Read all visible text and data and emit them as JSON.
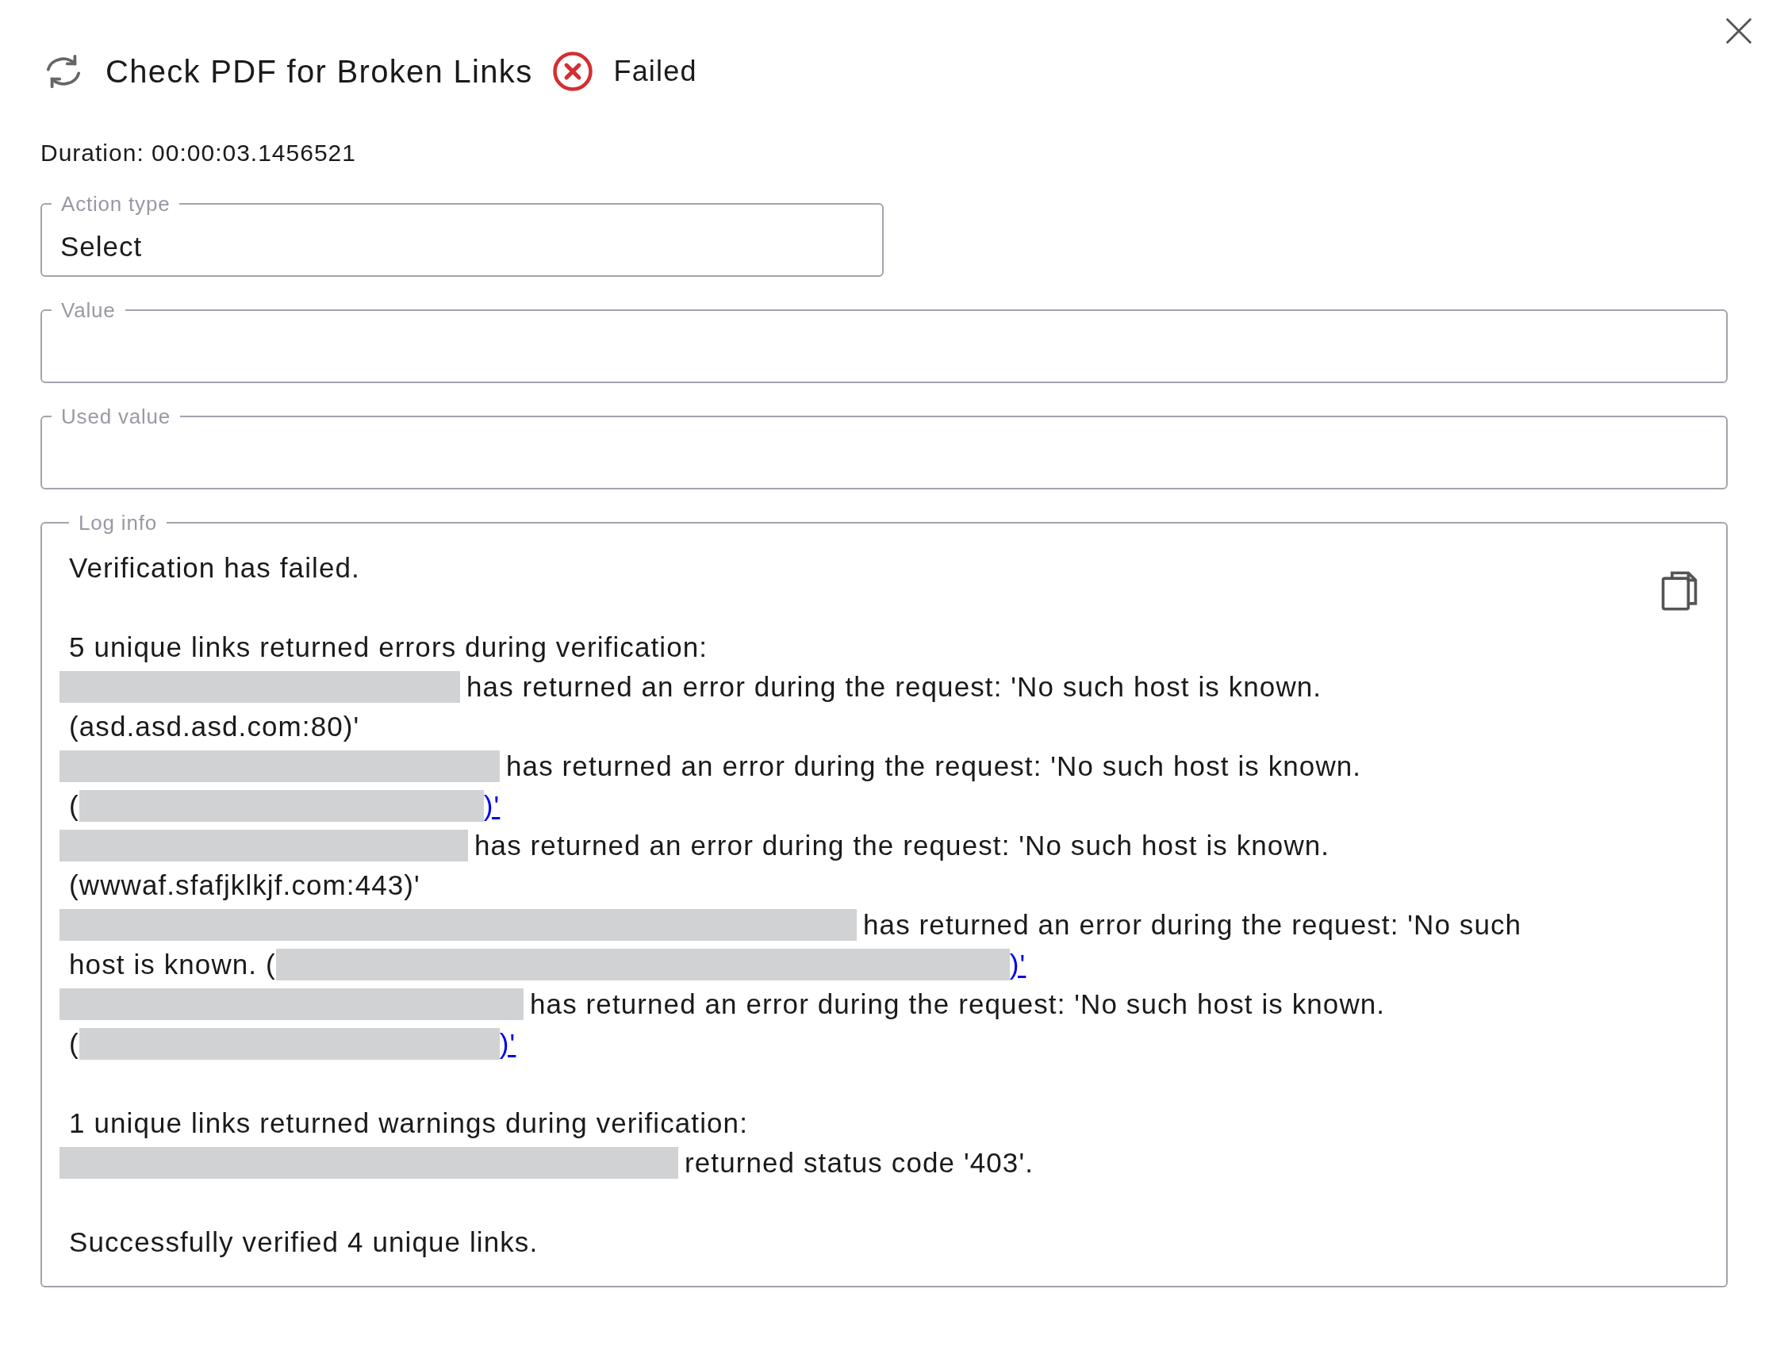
{
  "header": {
    "title": "Check PDF for Broken Links",
    "status": "Failed"
  },
  "duration": "Duration: 00:00:03.1456521",
  "fields": [
    {
      "label": "Action type",
      "value": "Select"
    },
    {
      "label": "Value"
    },
    {
      "label": "Used value"
    }
  ],
  "log": {
    "label": "Log info",
    "lines": [
      {
        "kind": "text",
        "text": "Verification has failed."
      },
      {
        "kind": "blank"
      },
      {
        "kind": "text",
        "text": "5 unique links returned errors during verification:"
      },
      {
        "kind": "redacted",
        "text": "has returned an error during the request: 'No such host is known."
      },
      {
        "kind": "text",
        "text": "(asd.asd.asd.com:80)'"
      },
      {
        "kind": "redacted",
        "text": "has returned an error during the request: 'No such host is known."
      },
      {
        "kind": "link",
        "open": "(",
        "close": ")'"
      },
      {
        "kind": "redacted",
        "text": "has returned an error during the request: 'No such host is known."
      },
      {
        "kind": "text",
        "text": "(wwwaf.sfafjklkjf.com:443)'"
      },
      {
        "kind": "redacted",
        "text": "has returned an error during the request: 'No such"
      },
      {
        "kind": "link",
        "open": "host is known. (",
        "close": ")'"
      },
      {
        "kind": "redacted",
        "text": "has returned an error during the request: 'No such host is known."
      },
      {
        "kind": "link",
        "open": "(",
        "close": ")'"
      },
      {
        "kind": "blank"
      },
      {
        "kind": "text",
        "text": "1 unique links returned warnings during verification:"
      },
      {
        "kind": "redacted",
        "text": "returned status code '403'."
      },
      {
        "kind": "blank"
      },
      {
        "kind": "text",
        "text": "Successfully verified 4 unique links."
      }
    ]
  }
}
